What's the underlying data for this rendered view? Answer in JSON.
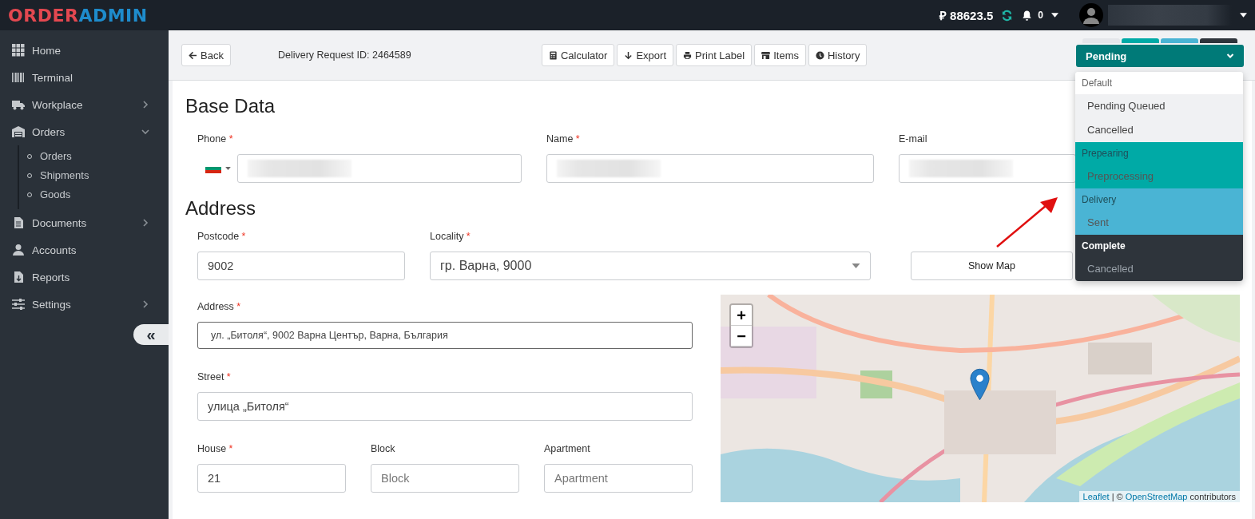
{
  "topbar": {
    "logo_first": "ORDER",
    "logo_second": "ADMIN",
    "balance": "₽ 88623.5",
    "notifications": "0"
  },
  "sidebar": {
    "items": [
      {
        "label": "Home",
        "kind": "grid"
      },
      {
        "label": "Terminal",
        "kind": "barcode"
      },
      {
        "label": "Workplace",
        "kind": "truck",
        "expanded": false
      },
      {
        "label": "Orders",
        "kind": "warehouse",
        "expanded": true,
        "children": [
          {
            "label": "Orders"
          },
          {
            "label": "Shipments"
          },
          {
            "label": "Goods"
          }
        ]
      },
      {
        "label": "Documents",
        "kind": "doc",
        "expanded": false
      },
      {
        "label": "Accounts",
        "kind": "user"
      },
      {
        "label": "Reports",
        "kind": "report"
      },
      {
        "label": "Settings",
        "kind": "sliders",
        "expanded": false
      }
    ],
    "collapse_button": "«"
  },
  "toolbar": {
    "back": "Back",
    "request_id": "Delivery Request ID: 2464589",
    "buttons": [
      {
        "label": "Calculator",
        "kind": "calculator"
      },
      {
        "label": "Export",
        "kind": "export"
      },
      {
        "label": "Print Label",
        "kind": "print"
      },
      {
        "label": "Items",
        "kind": "store"
      },
      {
        "label": "History",
        "kind": "clock"
      }
    ],
    "stages": [
      {
        "color": "#e4e6ea"
      },
      {
        "color": "#00aaa6"
      },
      {
        "color": "#4ab4d4"
      },
      {
        "color": "#2e343b"
      }
    ],
    "status": "Pending"
  },
  "status_menu": {
    "groups": [
      {
        "title": "Default",
        "color": "#ffffff",
        "items": [
          "Pending Queued",
          "Cancelled"
        ]
      },
      {
        "title": "Prepearing",
        "color": "#00aaa6",
        "items": [
          "Preprocessing"
        ]
      },
      {
        "title": "Delivery",
        "color": "#4ab4d4",
        "items": [
          "Sent"
        ]
      },
      {
        "title": "Complete",
        "color": "#2e343b",
        "items": [
          "Cancelled"
        ]
      }
    ]
  },
  "base_data": {
    "title": "Base Data",
    "phone_label": "Phone",
    "phone_required": "*",
    "name_label": "Name",
    "name_required": "*",
    "email_label": "E-mail"
  },
  "address": {
    "title": "Address",
    "postcode_label": "Postcode",
    "postcode_required": "*",
    "postcode": "9002",
    "locality_label": "Locality",
    "locality_required": "*",
    "locality": "гр. Варна, 9000",
    "show_map": "Show Map",
    "address_label": "Address",
    "address_required": "*",
    "address": "ул. „Битоля“, 9002 Варна Център, Варна, България",
    "street_label": "Street",
    "street_required": "*",
    "street": "улица „Битоля“",
    "house_label": "House",
    "house_required": "*",
    "house": "21",
    "block_label": "Block",
    "block_placeholder": "Block",
    "apartment_label": "Apartment",
    "apartment_placeholder": "Apartment"
  },
  "map": {
    "zoom_in": "+",
    "zoom_out": "−",
    "attribution_link1": "Leaflet",
    "attribution_sep": "| ©",
    "attribution_link2": "OpenStreetMap",
    "attribution_tail": "contributors"
  }
}
